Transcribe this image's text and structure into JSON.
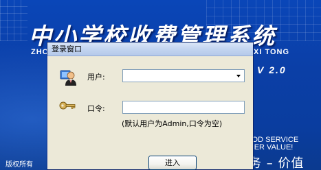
{
  "splash": {
    "title": "中小学校收费管理系统",
    "pinyin_left": "ZHO",
    "pinyin_right": "XI TONG",
    "version": "V 2.0",
    "slogan_en_1": "OOD SERVICE",
    "slogan_en_2": "OMER VALUE!",
    "slogan_cn": "务 – 价值",
    "copyright": "版权所有"
  },
  "dialog": {
    "title": "登录窗口",
    "user_label": "用户:",
    "user_value": "",
    "password_label": "口令:",
    "password_value": "",
    "hint": "(默认用户为Admin,口令为空)",
    "login_button": "进入"
  },
  "icons": {
    "user": "user-icon",
    "key": "key-icon",
    "dropdown": "chevron-down-icon"
  }
}
